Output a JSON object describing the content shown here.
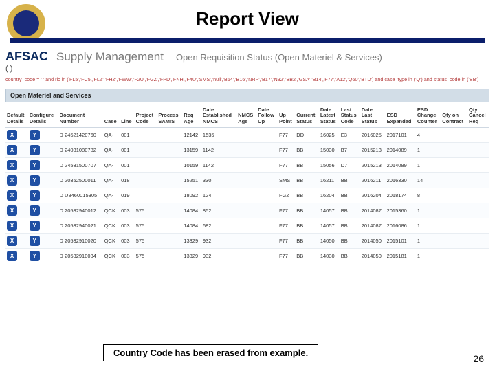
{
  "slide": {
    "title": "Report View",
    "note": "Country Code has been erased from example.",
    "page_number": "26"
  },
  "app": {
    "brand_a": "AFSAC",
    "brand_b": "Supply Management",
    "page": "Open Requisition Status (Open Materiel & Services)",
    "parens": "(                     )"
  },
  "filter_text": "country_code = '   ' and ric in ('FL5','FC5','FLZ','FHZ','FWW','F2U','FGZ','FPD','FNH','F4U','SMS','null','B64','B16','NRP','B17','N32','BB2','GSA','B14','F77','A12','Q60','BTD') and case_type in ('Q') and status_code in ('BB')",
  "panel_title": "Open Materiel and Services",
  "columns": [
    [
      "Default",
      "Details"
    ],
    [
      "Configure",
      "Details"
    ],
    [
      "Document",
      "Number"
    ],
    [
      "Case",
      ""
    ],
    [
      "Line",
      ""
    ],
    [
      "Project",
      "Code"
    ],
    [
      "Process",
      "SAMIS"
    ],
    [
      "Req",
      "Age"
    ],
    [
      "Date",
      "Established",
      "NMCS"
    ],
    [
      "NMCS",
      "Age"
    ],
    [
      "Date",
      "Follow",
      "Up"
    ],
    [
      "Up",
      "Point"
    ],
    [
      "Current",
      "Status"
    ],
    [
      "Date",
      "Latest",
      "Status"
    ],
    [
      "Last",
      "Status",
      "Code"
    ],
    [
      "Date",
      "Last",
      "Status"
    ],
    [
      "ESD",
      "Expanded"
    ],
    [
      "ESD",
      "Change",
      "Counter"
    ],
    [
      "Qty on",
      "Contract"
    ],
    [
      "Qty",
      "Cancel",
      "Req"
    ]
  ],
  "rows": [
    {
      "x": "X",
      "y": "Y",
      "doc": "D  24521420760",
      "case": "QA-",
      "line": "001",
      "proj": "",
      "proc": "",
      "reqage": "12142",
      "nmcsd": "1535",
      "nmcsa": "",
      "fup": "",
      "up": "F77",
      "cur": "DD",
      "dls": "16025",
      "lsc": "E3",
      "dls2": "2016025",
      "esd": "2017101",
      "chg": "4",
      "qty": "",
      "cancel": ""
    },
    {
      "x": "X",
      "y": "Y",
      "doc": "D  24031080782",
      "case": "QA-",
      "line": "001",
      "proj": "",
      "proc": "",
      "reqage": "13159",
      "nmcsd": "1142",
      "nmcsa": "",
      "fup": "",
      "up": "F77",
      "cur": "BB",
      "dls": "15030",
      "lsc": "B7",
      "dls2": "2015213",
      "esd": "2014089",
      "chg": "1",
      "qty": "",
      "cancel": ""
    },
    {
      "x": "X",
      "y": "Y",
      "doc": "D  24531500707",
      "case": "QA-",
      "line": "001",
      "proj": "",
      "proc": "",
      "reqage": "10159",
      "nmcsd": "1142",
      "nmcsa": "",
      "fup": "",
      "up": "F77",
      "cur": "BB",
      "dls": "15056",
      "lsc": "D7",
      "dls2": "2015213",
      "esd": "2014089",
      "chg": "1",
      "qty": "",
      "cancel": ""
    },
    {
      "x": "X",
      "y": "Y",
      "doc": "D  20352500011",
      "case": "QA-",
      "line": "018",
      "proj": "",
      "proc": "",
      "reqage": "15251",
      "nmcsd": "330",
      "nmcsa": "",
      "fup": "",
      "up": "SMS",
      "cur": "BB",
      "dls": "16211",
      "lsc": "BB",
      "dls2": "2016211",
      "esd": "2016330",
      "chg": "14",
      "qty": "",
      "cancel": ""
    },
    {
      "x": "X",
      "y": "Y",
      "doc": "D  U8460015305",
      "case": "QA-",
      "line": "019",
      "proj": "",
      "proc": "",
      "reqage": "18092",
      "nmcsd": "124",
      "nmcsa": "",
      "fup": "",
      "up": "FGZ",
      "cur": "BB",
      "dls": "16204",
      "lsc": "BB",
      "dls2": "2016204",
      "esd": "2018174",
      "chg": "8",
      "qty": "",
      "cancel": ""
    },
    {
      "x": "X",
      "y": "Y",
      "doc": "D  20532940012",
      "case": "QCK",
      "line": "003",
      "proj": "575",
      "proc": "",
      "reqage": "14084",
      "nmcsd": "852",
      "nmcsa": "",
      "fup": "",
      "up": "F77",
      "cur": "BB",
      "dls": "14057",
      "lsc": "BB",
      "dls2": "2014087",
      "esd": "2015360",
      "chg": "1",
      "qty": "",
      "cancel": ""
    },
    {
      "x": "X",
      "y": "Y",
      "doc": "D  20532940021",
      "case": "QCK",
      "line": "003",
      "proj": "575",
      "proc": "",
      "reqage": "14084",
      "nmcsd": "682",
      "nmcsa": "",
      "fup": "",
      "up": "F77",
      "cur": "BB",
      "dls": "14057",
      "lsc": "BB",
      "dls2": "2014087",
      "esd": "2016086",
      "chg": "1",
      "qty": "",
      "cancel": ""
    },
    {
      "x": "X",
      "y": "Y",
      "doc": "D  20532910020",
      "case": "QCK",
      "line": "003",
      "proj": "575",
      "proc": "",
      "reqage": "13329",
      "nmcsd": "932",
      "nmcsa": "",
      "fup": "",
      "up": "F77",
      "cur": "BB",
      "dls": "14050",
      "lsc": "BB",
      "dls2": "2014050",
      "esd": "2015101",
      "chg": "1",
      "qty": "",
      "cancel": ""
    },
    {
      "x": "X",
      "y": "Y",
      "doc": "D  20532910034",
      "case": "QCK",
      "line": "003",
      "proj": "575",
      "proc": "",
      "reqage": "13329",
      "nmcsd": "932",
      "nmcsa": "",
      "fup": "",
      "up": "F77",
      "cur": "BB",
      "dls": "14030",
      "lsc": "BB",
      "dls2": "2014050",
      "esd": "2015181",
      "chg": "1",
      "qty": "",
      "cancel": ""
    }
  ]
}
